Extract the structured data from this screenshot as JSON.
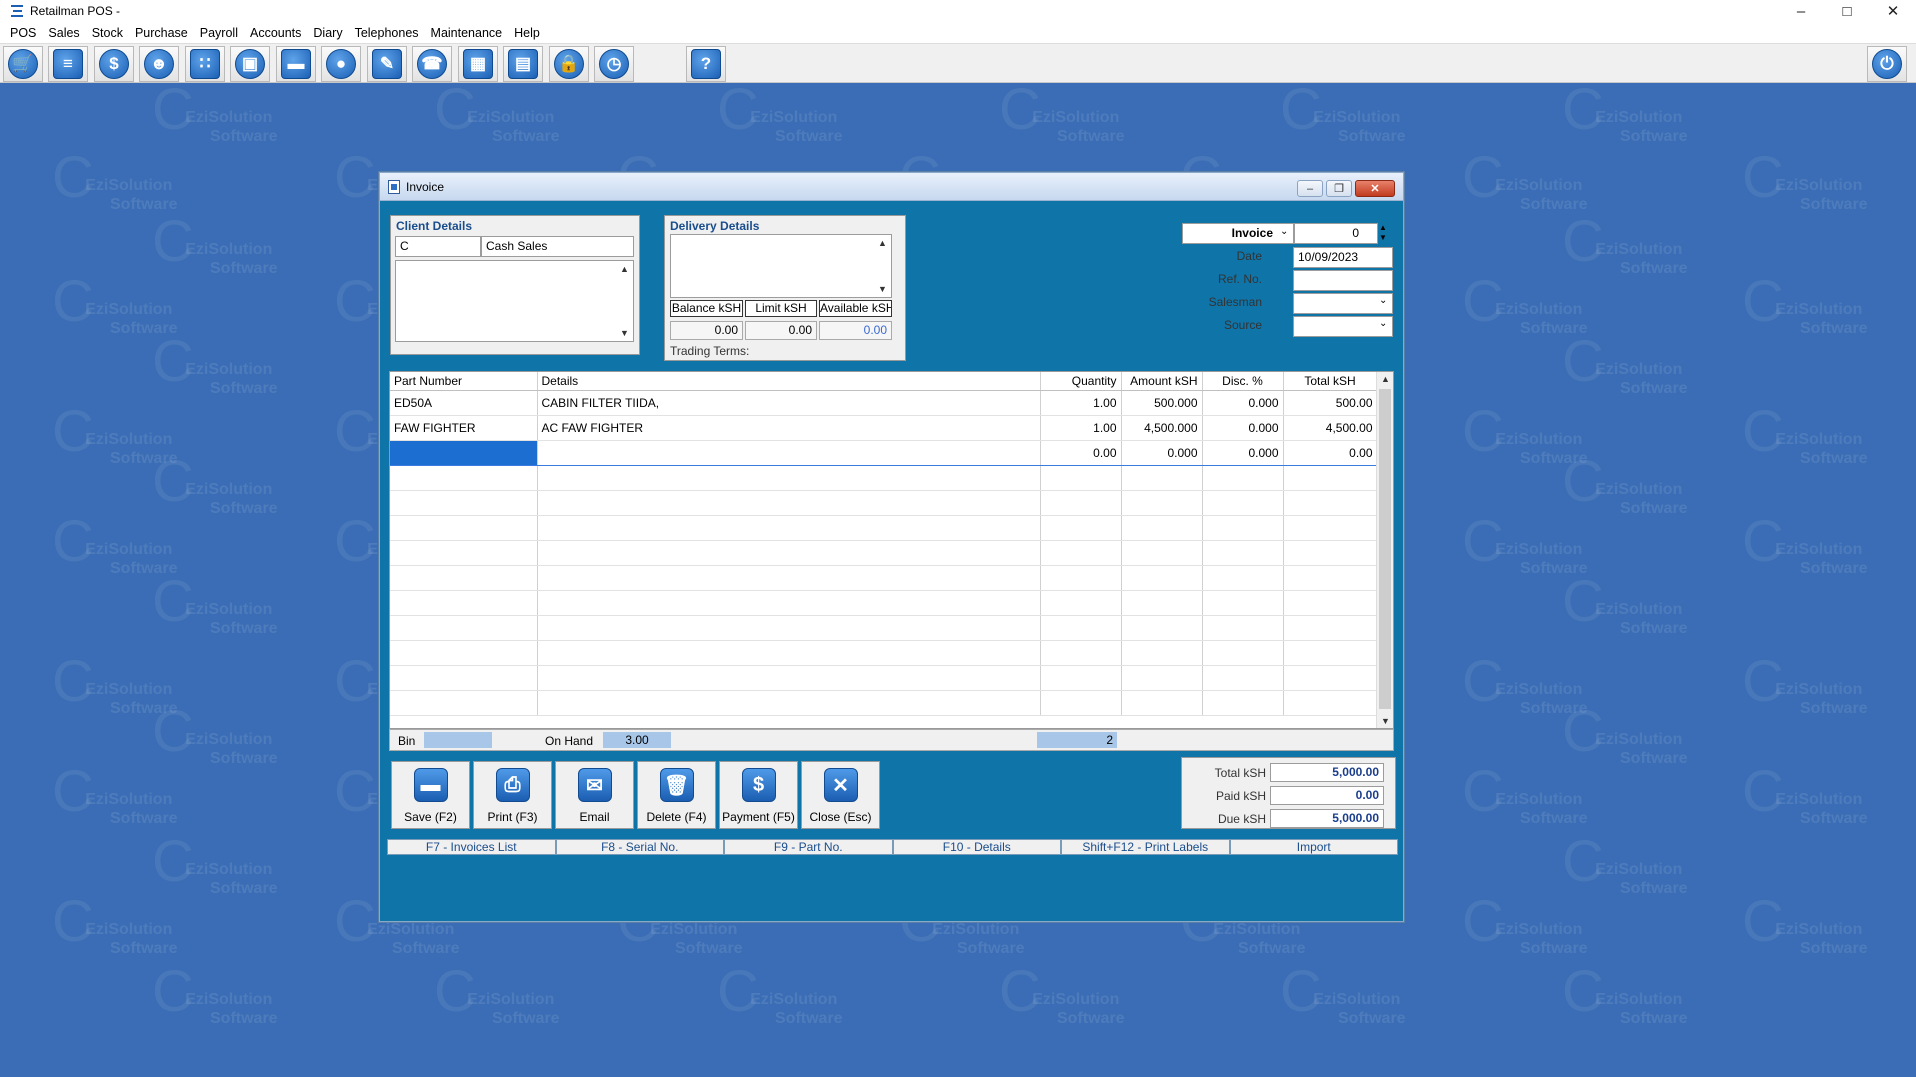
{
  "window": {
    "title": "Retailman POS -"
  },
  "menu": [
    "POS",
    "Sales",
    "Stock",
    "Purchase",
    "Payroll",
    "Accounts",
    "Diary",
    "Telephones",
    "Maintenance",
    "Help"
  ],
  "toolbar_icons": [
    "cart-icon",
    "document-icon",
    "dollar-icon",
    "users-icon",
    "grid-dots-icon",
    "box-icon",
    "card-icon",
    "person-icon",
    "edit-icon",
    "phone-icon",
    "table-icon",
    "calculator-icon",
    "lock-icon",
    "clock-icon",
    "help-icon",
    "power-icon"
  ],
  "watermark": {
    "line1": "EziSolution",
    "line2": "Software"
  },
  "invoice": {
    "title": "Invoice",
    "client": {
      "label": "Client Details",
      "code": "C",
      "name": "Cash Sales"
    },
    "delivery": {
      "label": "Delivery Details",
      "balance_label": "Balance kSH",
      "limit_label": "Limit kSH",
      "available_label": "Available kSH",
      "balance": "0.00",
      "limit": "0.00",
      "available": "0.00",
      "trading_terms_label": "Trading Terms:"
    },
    "header": {
      "doc_type": "Invoice",
      "number": "0",
      "date_label": "Date",
      "date": "10/09/2023",
      "ref_label": "Ref. No.",
      "ref": "",
      "salesman_label": "Salesman",
      "salesman": "",
      "source_label": "Source",
      "source": ""
    },
    "columns": [
      "Part Number",
      "Details",
      "Quantity",
      "Amount kSH",
      "Disc. %",
      "Total kSH"
    ],
    "rows": [
      {
        "part": "ED50A",
        "details": "CABIN FILTER TIIDA,",
        "qty": "1.00",
        "amount": "500.000",
        "disc": "0.000",
        "total": "500.00"
      },
      {
        "part": "FAW FIGHTER",
        "details": "AC FAW FIGHTER",
        "qty": "1.00",
        "amount": "4,500.000",
        "disc": "0.000",
        "total": "4,500.00"
      },
      {
        "part": "",
        "details": "",
        "qty": "0.00",
        "amount": "0.000",
        "disc": "0.000",
        "total": "0.00"
      }
    ],
    "status": {
      "bin_label": "Bin",
      "bin": "",
      "on_hand_label": "On Hand",
      "on_hand": "3.00",
      "line_count": "2"
    },
    "buttons": {
      "save": "Save (F2)",
      "print": "Print (F3)",
      "email": "Email",
      "delete": "Delete (F4)",
      "payment": "Payment (F5)",
      "close": "Close (Esc)"
    },
    "totals": {
      "total_label": "Total kSH",
      "total": "5,000.00",
      "paid_label": "Paid kSH",
      "paid": "0.00",
      "due_label": "Due kSH",
      "due": "5,000.00"
    },
    "fkeys": [
      "F7 - Invoices List",
      "F8 - Serial No.",
      "F9 - Part No.",
      "F10 - Details",
      "Shift+F12 - Print Labels",
      "Import"
    ]
  },
  "colors": {
    "desktop": "#3a6db5",
    "window_body": "#0f74a8",
    "selection": "#1c6fd1"
  }
}
